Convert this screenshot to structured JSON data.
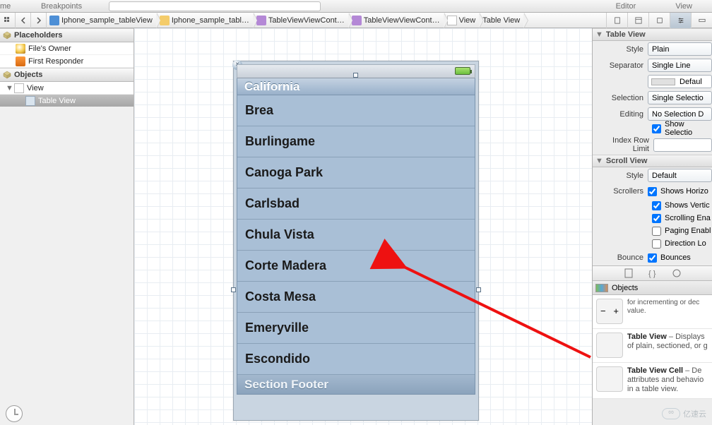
{
  "tabs": {
    "left_label": "me",
    "breakpoints": "Breakpoints",
    "editor": "Editor",
    "view": "View"
  },
  "jump": {
    "project": "Iphone_sample_tableView",
    "folder": "Iphone_sample_tabl…",
    "file1": "TableViewViewCont…",
    "file2": "TableViewViewCont…",
    "view": "View",
    "tableview": "Table View"
  },
  "placeholders": {
    "title": "Placeholders",
    "owner": "File's Owner",
    "responder": "First Responder"
  },
  "objects": {
    "title": "Objects",
    "view": "View",
    "tableview": "Table View"
  },
  "device": {
    "section_header": "California",
    "rows": [
      "Brea",
      "Burlingame",
      "Canoga Park",
      "Carlsbad",
      "Chula Vista",
      "Corte Madera",
      "Costa Mesa",
      "Emeryville",
      "Escondido"
    ],
    "section_footer": "Section Footer"
  },
  "inspector": {
    "table_view_title": "Table View",
    "style_label": "Style",
    "style_value": "Plain",
    "separator_label": "Separator",
    "separator_value": "Single Line",
    "default_label": "Defaul",
    "selection_label": "Selection",
    "selection_value": "Single Selectio",
    "editing_label": "Editing",
    "editing_value": "No Selection D",
    "show_selection": "Show Selectio",
    "index_row_limit": "Index Row Limit",
    "scroll_view_title": "Scroll View",
    "sv_style_label": "Style",
    "sv_style_value": "Default",
    "scrollers_label": "Scrollers",
    "shows_horiz": "Shows Horizo",
    "shows_vert": "Shows Vertic",
    "scrolling_en": "Scrolling Ena",
    "paging_en": "Paging Enabl",
    "direction_lock": "Direction Lo",
    "bounce_label": "Bounce",
    "bounces": "Bounces"
  },
  "library": {
    "title": "Objects",
    "stepper_desc": "for incrementing or dec value.",
    "tableview_title": "Table View",
    "tableview_desc": " – Displays of plain, sectioned, or g",
    "cell_title": "Table View Cell",
    "cell_desc": " – De attributes and behavio in a table view."
  },
  "watermark": "亿速云"
}
